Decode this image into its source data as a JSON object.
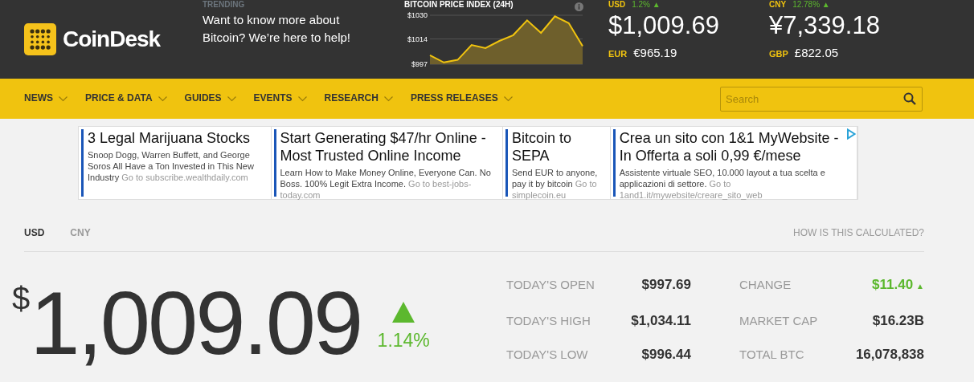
{
  "header": {
    "logo": "CoinDesk",
    "trending": {
      "label": "TRENDING",
      "text": "Want to know more about Bitcoin? We’re here to help!"
    },
    "price_index": {
      "chart_data": {
        "type": "area",
        "title": "BITCOIN PRICE INDEX (24H)",
        "values": [
          1003,
          998.2,
          999.9,
          1010,
          1007.9,
          1012.7,
          1016.6,
          1026.6,
          1018.1,
          1029.3,
          1024.7,
          1009.1
        ],
        "ylim": [
          997,
          1030
        ],
        "yticks": [
          {
            "value": 1030,
            "label": "$1030"
          },
          {
            "value": 1014,
            "label": "$1014"
          },
          {
            "value": 997,
            "label": "$997"
          }
        ]
      }
    },
    "quotes": [
      {
        "currency": "USD",
        "change": "1.2% ▲",
        "price": "$1,009.69",
        "sub_currency": "EUR",
        "sub_price": "€965.19"
      },
      {
        "currency": "CNY",
        "change": "12.78% ▲",
        "price": "¥7,339.18",
        "sub_currency": "GBP",
        "sub_price": "£822.05"
      }
    ]
  },
  "nav": {
    "items": [
      "NEWS",
      "PRICE & DATA",
      "GUIDES",
      "EVENTS",
      "RESEARCH",
      "PRESS RELEASES"
    ],
    "search": {
      "placeholder": "Search"
    }
  },
  "ads": [
    {
      "headline": "3 Legal Marijuana Stocks",
      "description": "Snoop Dogg, Warren Buffett, and George Soros All Have a Ton Invested in This New Industry",
      "link": "Go to subscribe.wealthdaily.com"
    },
    {
      "headline": "Start Generating $47/hr Online - Most Trusted Online Income",
      "description": "Learn How to Make Money Online, Everyone Can. No Boss. 100% Legit Extra Income.",
      "link": "Go to best-jobs-today.com"
    },
    {
      "headline": "Bitcoin to SEPA",
      "description": "Send EUR to anyone, pay it by bitcoin",
      "link": "Go to simplecoin.eu"
    },
    {
      "headline": "Crea un sito con 1&1 MyWebsite - In Offerta a soli 0,99 €/mese",
      "description": "Assistente virtuale SEO, 10.000 layout a tua scelta e applicazioni di settore.",
      "link": "Go to 1and1.it/mywebsite/creare_sito_web"
    }
  ],
  "tabs": [
    {
      "label": "USD",
      "selected": true
    },
    {
      "label": "CNY",
      "selected": false
    }
  ],
  "calc_link": "HOW IS THIS CALCULATED?",
  "price": {
    "symbol": "$",
    "value": "1,009.09",
    "rising": true,
    "change": "1.14%"
  },
  "stats": [
    {
      "label": "TODAY'S OPEN",
      "value": "$997.69",
      "kind": "plain"
    },
    {
      "label": "CHANGE",
      "value": "$11.40",
      "arrow": "▲",
      "kind": "change"
    },
    {
      "label": "TODAY'S HIGH",
      "value": "$1,034.11",
      "kind": "plain"
    },
    {
      "label": "MARKET CAP",
      "value": "$16.23B",
      "kind": "plain"
    },
    {
      "label": "TODAY'S LOW",
      "value": "$996.44",
      "kind": "plain"
    },
    {
      "label": "TOTAL BTC",
      "value": "16,078,838",
      "kind": "plain"
    }
  ]
}
